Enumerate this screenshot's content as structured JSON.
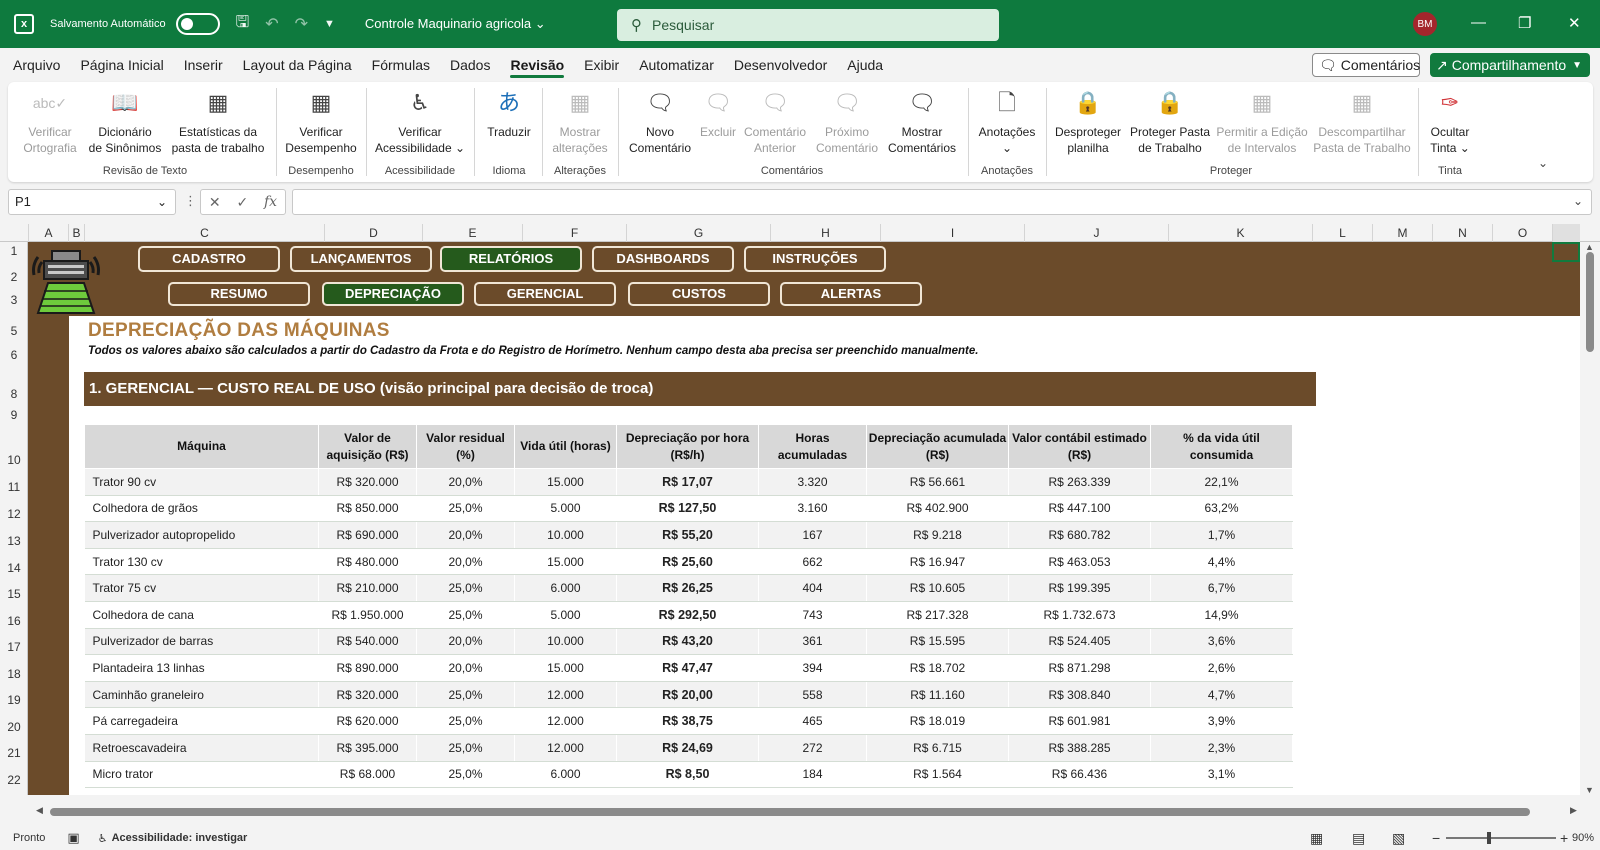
{
  "titlebar": {
    "autosave_label": "Salvamento Automático",
    "doc_name": "Controle Maquinario agricola",
    "search_placeholder": "Pesquisar",
    "avatar_initials": "BM"
  },
  "menu": [
    "Arquivo",
    "Página Inicial",
    "Inserir",
    "Layout da Página",
    "Fórmulas",
    "Dados",
    "Revisão",
    "Exibir",
    "Automatizar",
    "Desenvolvedor",
    "Ajuda"
  ],
  "menu_active": "Revisão",
  "comments_btn": "Comentários",
  "share_btn": "Compartilhamento",
  "ribbon": {
    "spell_1": "Verificar",
    "spell_2": "Ortografia",
    "thes_1": "Dicionário",
    "thes_2": "de Sinônimos",
    "stats_1": "Estatísticas da",
    "stats_2": "pasta de trabalho",
    "perf_1": "Verificar",
    "perf_2": "Desempenho",
    "acc_1": "Verificar",
    "acc_2": "Acessibilidade",
    "translate": "Traduzir",
    "changes_1": "Mostrar",
    "changes_2": "alterações",
    "newc_1": "Novo",
    "newc_2": "Comentário",
    "delete": "Excluir",
    "prev_1": "Comentário",
    "prev_2": "Anterior",
    "next_1": "Próximo",
    "next_2": "Comentário",
    "show_1": "Mostrar",
    "show_2": "Comentários",
    "notes": "Anotações",
    "unprot_1": "Desproteger",
    "unprot_2": "planilha",
    "protwb_1": "Proteger Pasta",
    "protwb_2": "de Trabalho",
    "allow_1": "Permitir a Edição",
    "allow_2": "de Intervalos",
    "unshare_1": "Descompartilhar",
    "unshare_2": "Pasta de Trabalho",
    "ink_1": "Ocultar",
    "ink_2": "Tinta",
    "g_proofing": "Revisão de Texto",
    "g_perf": "Desempenho",
    "g_acc": "Acessibilidade",
    "g_lang": "Idioma",
    "g_changes": "Alterações",
    "g_comments": "Comentários",
    "g_notes": "Anotações",
    "g_protect": "Proteger",
    "g_ink": "Tinta"
  },
  "namebox": "P1",
  "columns": [
    "A",
    "B",
    "C",
    "D",
    "E",
    "F",
    "G",
    "H",
    "I",
    "J",
    "K",
    "L",
    "M",
    "N",
    "O"
  ],
  "rows": [
    "1",
    "2",
    "3",
    "5",
    "6",
    "8",
    "9",
    "10",
    "11",
    "12",
    "13",
    "14",
    "15",
    "16",
    "17",
    "18",
    "19",
    "20",
    "21",
    "22"
  ],
  "nav": {
    "row1": [
      "CADASTRO",
      "LANÇAMENTOS",
      "RELATÓRIOS",
      "DASHBOARDS",
      "INSTRUÇÕES"
    ],
    "row2": [
      "RESUMO",
      "DEPRECIAÇÃO",
      "GERENCIAL",
      "CUSTOS",
      "ALERTAS"
    ]
  },
  "page_title": "DEPRECIAÇÃO DAS MÁQUINAS",
  "subtitle": "Todos os valores abaixo são calculados a partir do Cadastro da Frota e do Registro de Horímetro. Nenhum campo desta aba precisa ser preenchido manualmente.",
  "section_title": "1. GERENCIAL — CUSTO REAL DE USO (visão principal para decisão de troca)",
  "table": {
    "headers": [
      [
        "Máquina"
      ],
      [
        "Valor de",
        "aquisição (R$)"
      ],
      [
        "Valor residual",
        "(%)"
      ],
      [
        "Vida útil (horas)"
      ],
      [
        "Depreciação por hora",
        "(R$/h)"
      ],
      [
        "Horas",
        "acumuladas"
      ],
      [
        "Depreciação acumulada",
        "(R$)"
      ],
      [
        "Valor contábil estimado",
        "(R$)"
      ],
      [
        "% da vida útil",
        "consumida"
      ]
    ],
    "rows": [
      [
        "Trator 90 cv",
        "R$ 320.000",
        "20,0%",
        "15.000",
        "R$ 17,07",
        "3.320",
        "R$ 56.661",
        "R$ 263.339",
        "22,1%"
      ],
      [
        "Colhedora de grãos",
        "R$ 850.000",
        "25,0%",
        "5.000",
        "R$ 127,50",
        "3.160",
        "R$ 402.900",
        "R$ 447.100",
        "63,2%"
      ],
      [
        "Pulverizador autopropelido",
        "R$ 690.000",
        "20,0%",
        "10.000",
        "R$ 55,20",
        "167",
        "R$ 9.218",
        "R$ 680.782",
        "1,7%"
      ],
      [
        "Trator 130 cv",
        "R$ 480.000",
        "20,0%",
        "15.000",
        "R$ 25,60",
        "662",
        "R$ 16.947",
        "R$ 463.053",
        "4,4%"
      ],
      [
        "Trator 75 cv",
        "R$ 210.000",
        "25,0%",
        "6.000",
        "R$ 26,25",
        "404",
        "R$ 10.605",
        "R$ 199.395",
        "6,7%"
      ],
      [
        "Colhedora de cana",
        "R$ 1.950.000",
        "25,0%",
        "5.000",
        "R$ 292,50",
        "743",
        "R$ 217.328",
        "R$ 1.732.673",
        "14,9%"
      ],
      [
        "Pulverizador de barras",
        "R$ 540.000",
        "20,0%",
        "10.000",
        "R$ 43,20",
        "361",
        "R$ 15.595",
        "R$ 524.405",
        "3,6%"
      ],
      [
        "Plantadeira 13 linhas",
        "R$ 890.000",
        "20,0%",
        "15.000",
        "R$ 47,47",
        "394",
        "R$ 18.702",
        "R$ 871.298",
        "2,6%"
      ],
      [
        "Caminhão graneleiro",
        "R$ 320.000",
        "25,0%",
        "12.000",
        "R$ 20,00",
        "558",
        "R$ 11.160",
        "R$ 308.840",
        "4,7%"
      ],
      [
        "Pá carregadeira",
        "R$ 620.000",
        "25,0%",
        "12.000",
        "R$ 38,75",
        "465",
        "R$ 18.019",
        "R$ 601.981",
        "3,9%"
      ],
      [
        "Retroescavadeira",
        "R$ 395.000",
        "25,0%",
        "12.000",
        "R$ 24,69",
        "272",
        "R$ 6.715",
        "R$ 388.285",
        "2,3%"
      ],
      [
        "Micro trator",
        "R$ 68.000",
        "25,0%",
        "6.000",
        "R$ 8,50",
        "184",
        "R$ 1.564",
        "R$ 66.436",
        "3,1%"
      ]
    ]
  },
  "status": {
    "ready": "Pronto",
    "accessibility": "Acessibilidade: investigar",
    "zoom": "90%"
  },
  "colors": {
    "excel_green": "#0e7a3e",
    "brown": "#6b4b2a",
    "selected_nav": "#255a1c",
    "title_gold": "#b07d40"
  }
}
